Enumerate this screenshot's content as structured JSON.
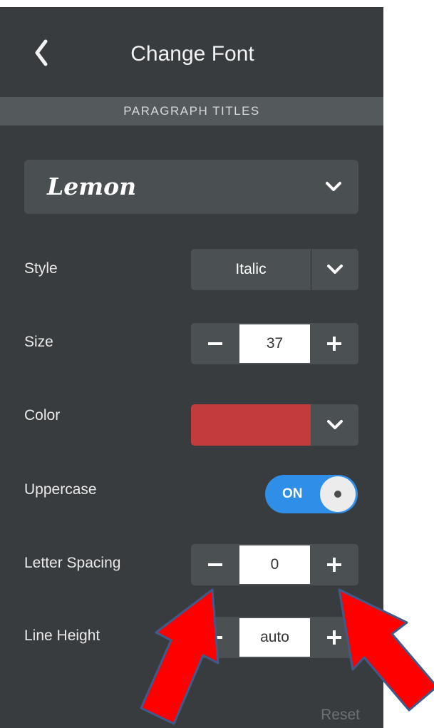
{
  "header": {
    "title": "Change Font",
    "back_icon": "chevron-left-icon"
  },
  "section": {
    "label": "PARAGRAPH TITLES"
  },
  "font": {
    "selected": "Lemon",
    "chevron_icon": "chevron-down-icon"
  },
  "rows": {
    "style": {
      "label": "Style",
      "value": "Italic"
    },
    "size": {
      "label": "Size",
      "value": "37"
    },
    "color": {
      "label": "Color",
      "value_hex": "#c23c3c"
    },
    "uppercase": {
      "label": "Uppercase",
      "state": "ON",
      "accent": "#2f8fe8"
    },
    "letter_spacing": {
      "label": "Letter Spacing",
      "value": "0"
    },
    "line_height": {
      "label": "Line Height",
      "value": "auto"
    }
  },
  "footer": {
    "reset_label": "Reset"
  },
  "annotations": {
    "arrow_color": "#ff0000",
    "arrow_outline": "#3f5a8a"
  }
}
